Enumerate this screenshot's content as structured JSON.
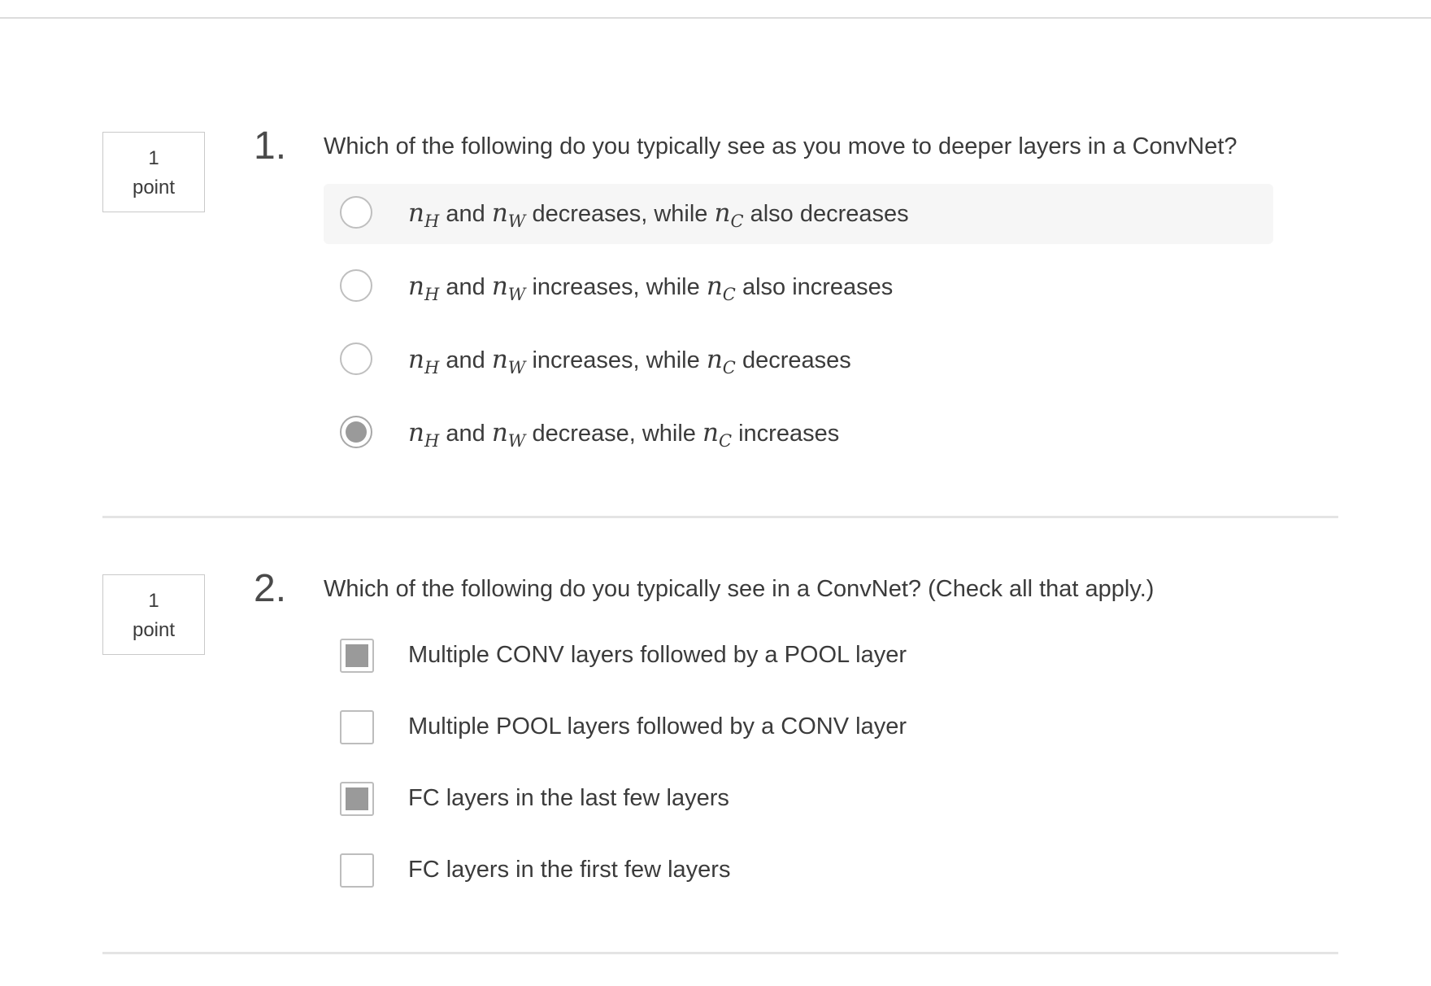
{
  "questions": [
    {
      "points_value": "1",
      "points_unit": "point",
      "number": "1.",
      "text": "Which of the following do you typically see as you move to deeper layers in a ConvNet?",
      "type": "radio",
      "options": [
        {
          "parts": [
            "and",
            "decreases, while",
            "also decreases"
          ],
          "selected": false
        },
        {
          "parts": [
            "and",
            "increases, while",
            "also increases"
          ],
          "selected": false
        },
        {
          "parts": [
            "and",
            "increases, while",
            "decreases"
          ],
          "selected": false
        },
        {
          "parts": [
            "and",
            "decrease, while",
            "increases"
          ],
          "selected": true
        }
      ],
      "math": {
        "var": "n",
        "sub_h": "H",
        "sub_w": "W",
        "sub_c": "C"
      }
    },
    {
      "points_value": "1",
      "points_unit": "point",
      "number": "2.",
      "text": "Which of the following do you typically see in a ConvNet? (Check all that apply.)",
      "type": "checkbox",
      "options": [
        {
          "label": "Multiple CONV layers followed by a POOL layer",
          "selected": true
        },
        {
          "label": "Multiple POOL layers followed by a CONV layer",
          "selected": false
        },
        {
          "label": "FC layers in the last few layers",
          "selected": true
        },
        {
          "label": "FC layers in the first few layers",
          "selected": false
        }
      ]
    }
  ],
  "colors": {
    "text": "#3b3b3b",
    "selected_fill": "#9a9a9a",
    "border": "#bfbfbf",
    "hover_bg": "#f6f6f6"
  }
}
